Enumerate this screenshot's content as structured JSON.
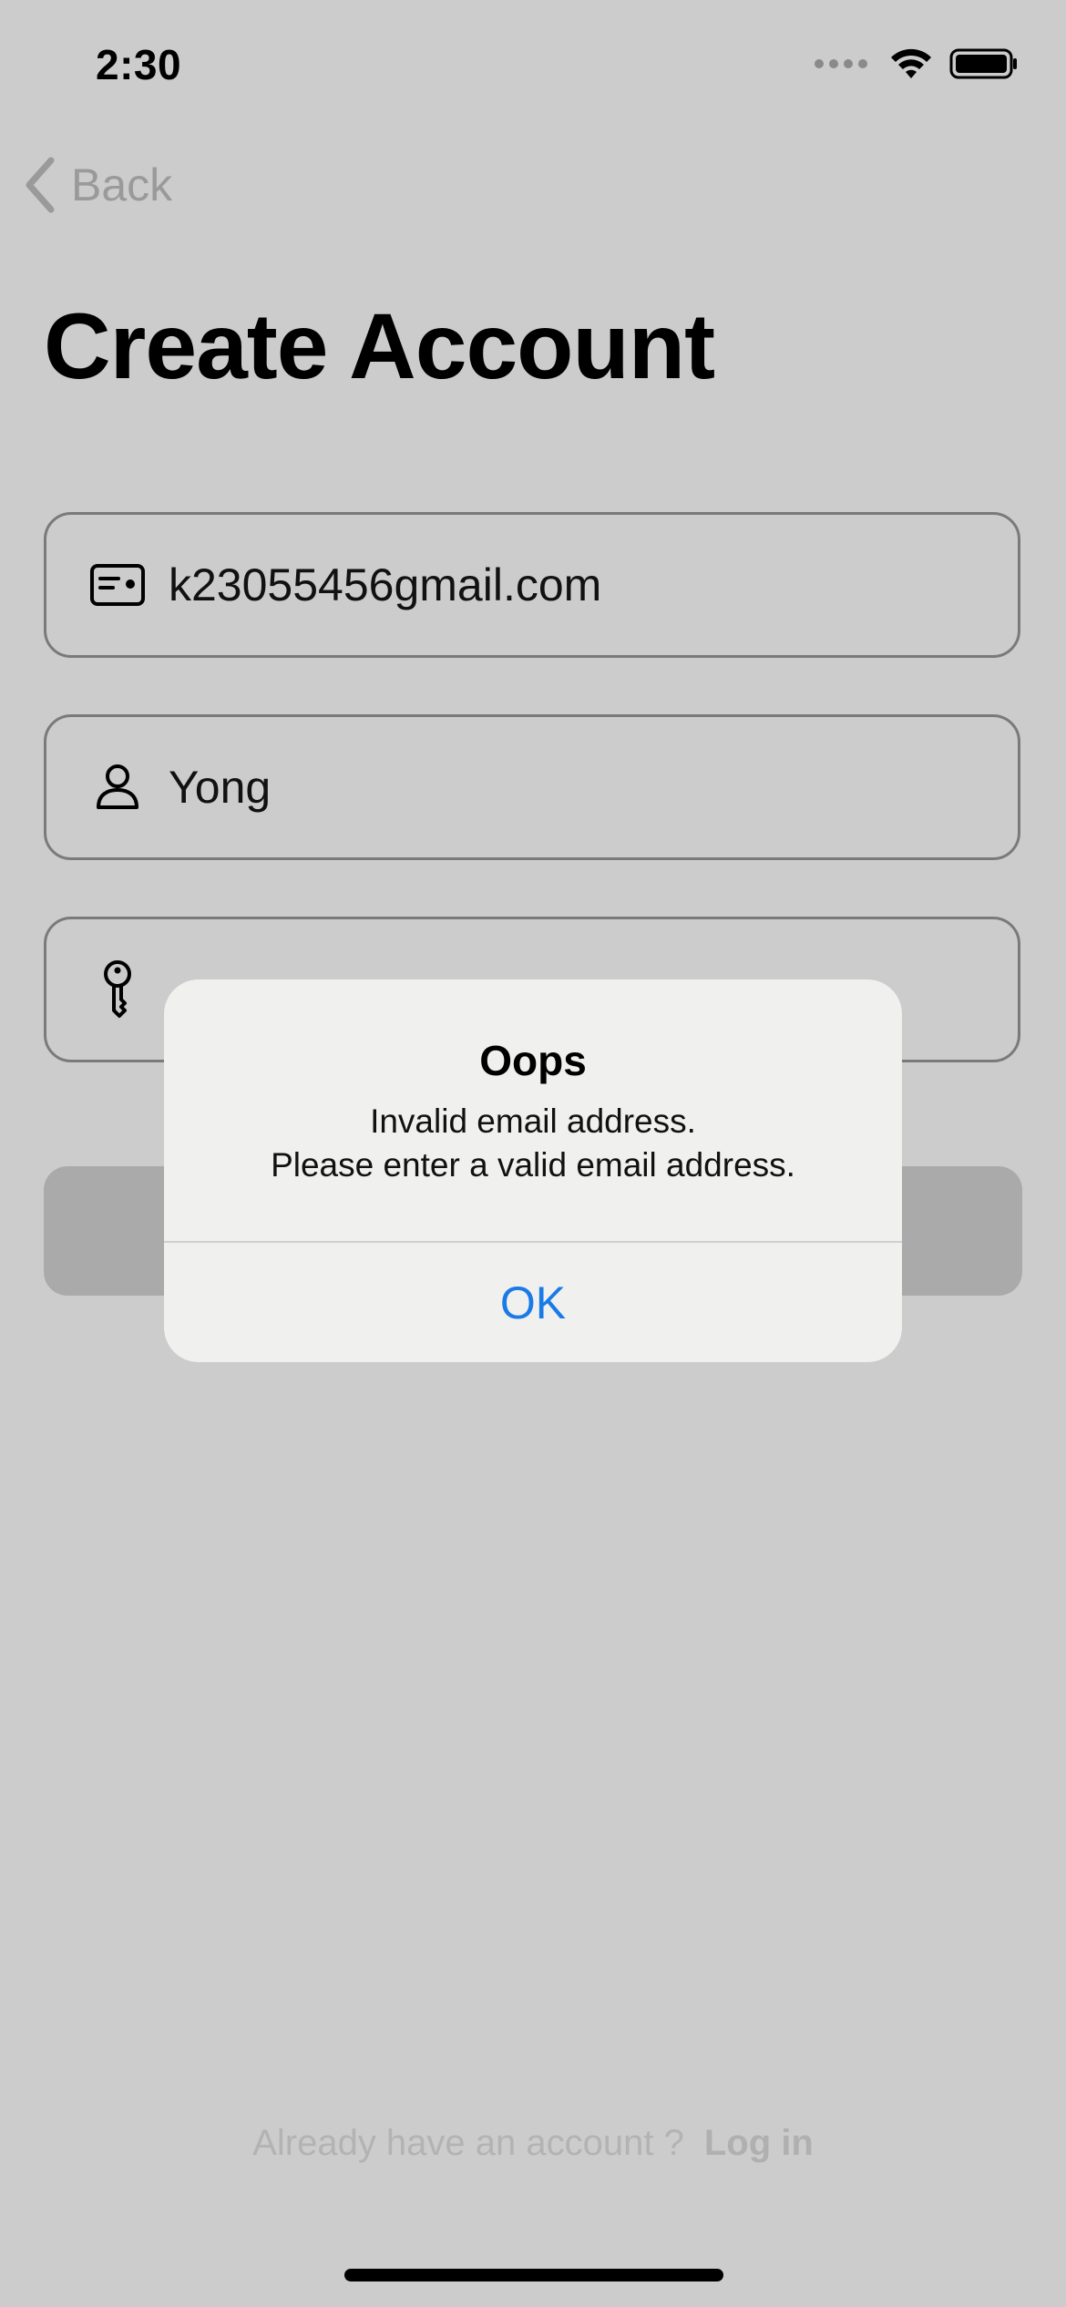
{
  "status_bar": {
    "time": "2:30",
    "icons": [
      "cellular-icon",
      "wifi-icon",
      "battery-icon"
    ]
  },
  "nav": {
    "back_label": "Back",
    "back_icon": "chevron-left-icon"
  },
  "page": {
    "title": "Create Account"
  },
  "form": {
    "email": {
      "value": "k23055456gmail.com",
      "icon": "id-card-icon"
    },
    "name": {
      "value": "Yong",
      "icon": "person-icon"
    },
    "password": {
      "icon": "key-icon"
    }
  },
  "alert": {
    "title": "Oops",
    "message_line1": "Invalid email address.",
    "message_line2": "Please enter a valid email address.",
    "ok_label": "OK"
  },
  "footer": {
    "prompt": "Already have an account ?",
    "login_label": "Log in"
  },
  "colors": {
    "background": "#cccccc",
    "alert_background": "#f0f0ef",
    "accent": "#1a7be6",
    "disabled_button": "#aaaaaa"
  }
}
